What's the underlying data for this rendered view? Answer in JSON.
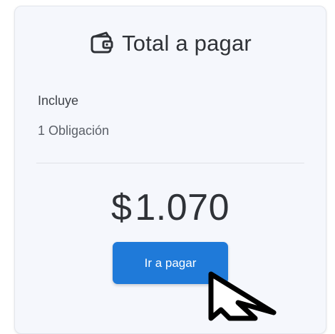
{
  "card": {
    "title": "Total a pagar",
    "icon": "wallet-icon",
    "includes_label": "Incluye",
    "includes_count": "1 Obligación",
    "currency_symbol": "$",
    "amount": "1.070",
    "pay_button_label": "Ir a pagar"
  },
  "colors": {
    "card_background": "#f5f7fc",
    "button_background": "#1f7ad9",
    "text_primary": "#2f3237"
  },
  "cursor": {
    "icon": "mouse-pointer-icon"
  }
}
